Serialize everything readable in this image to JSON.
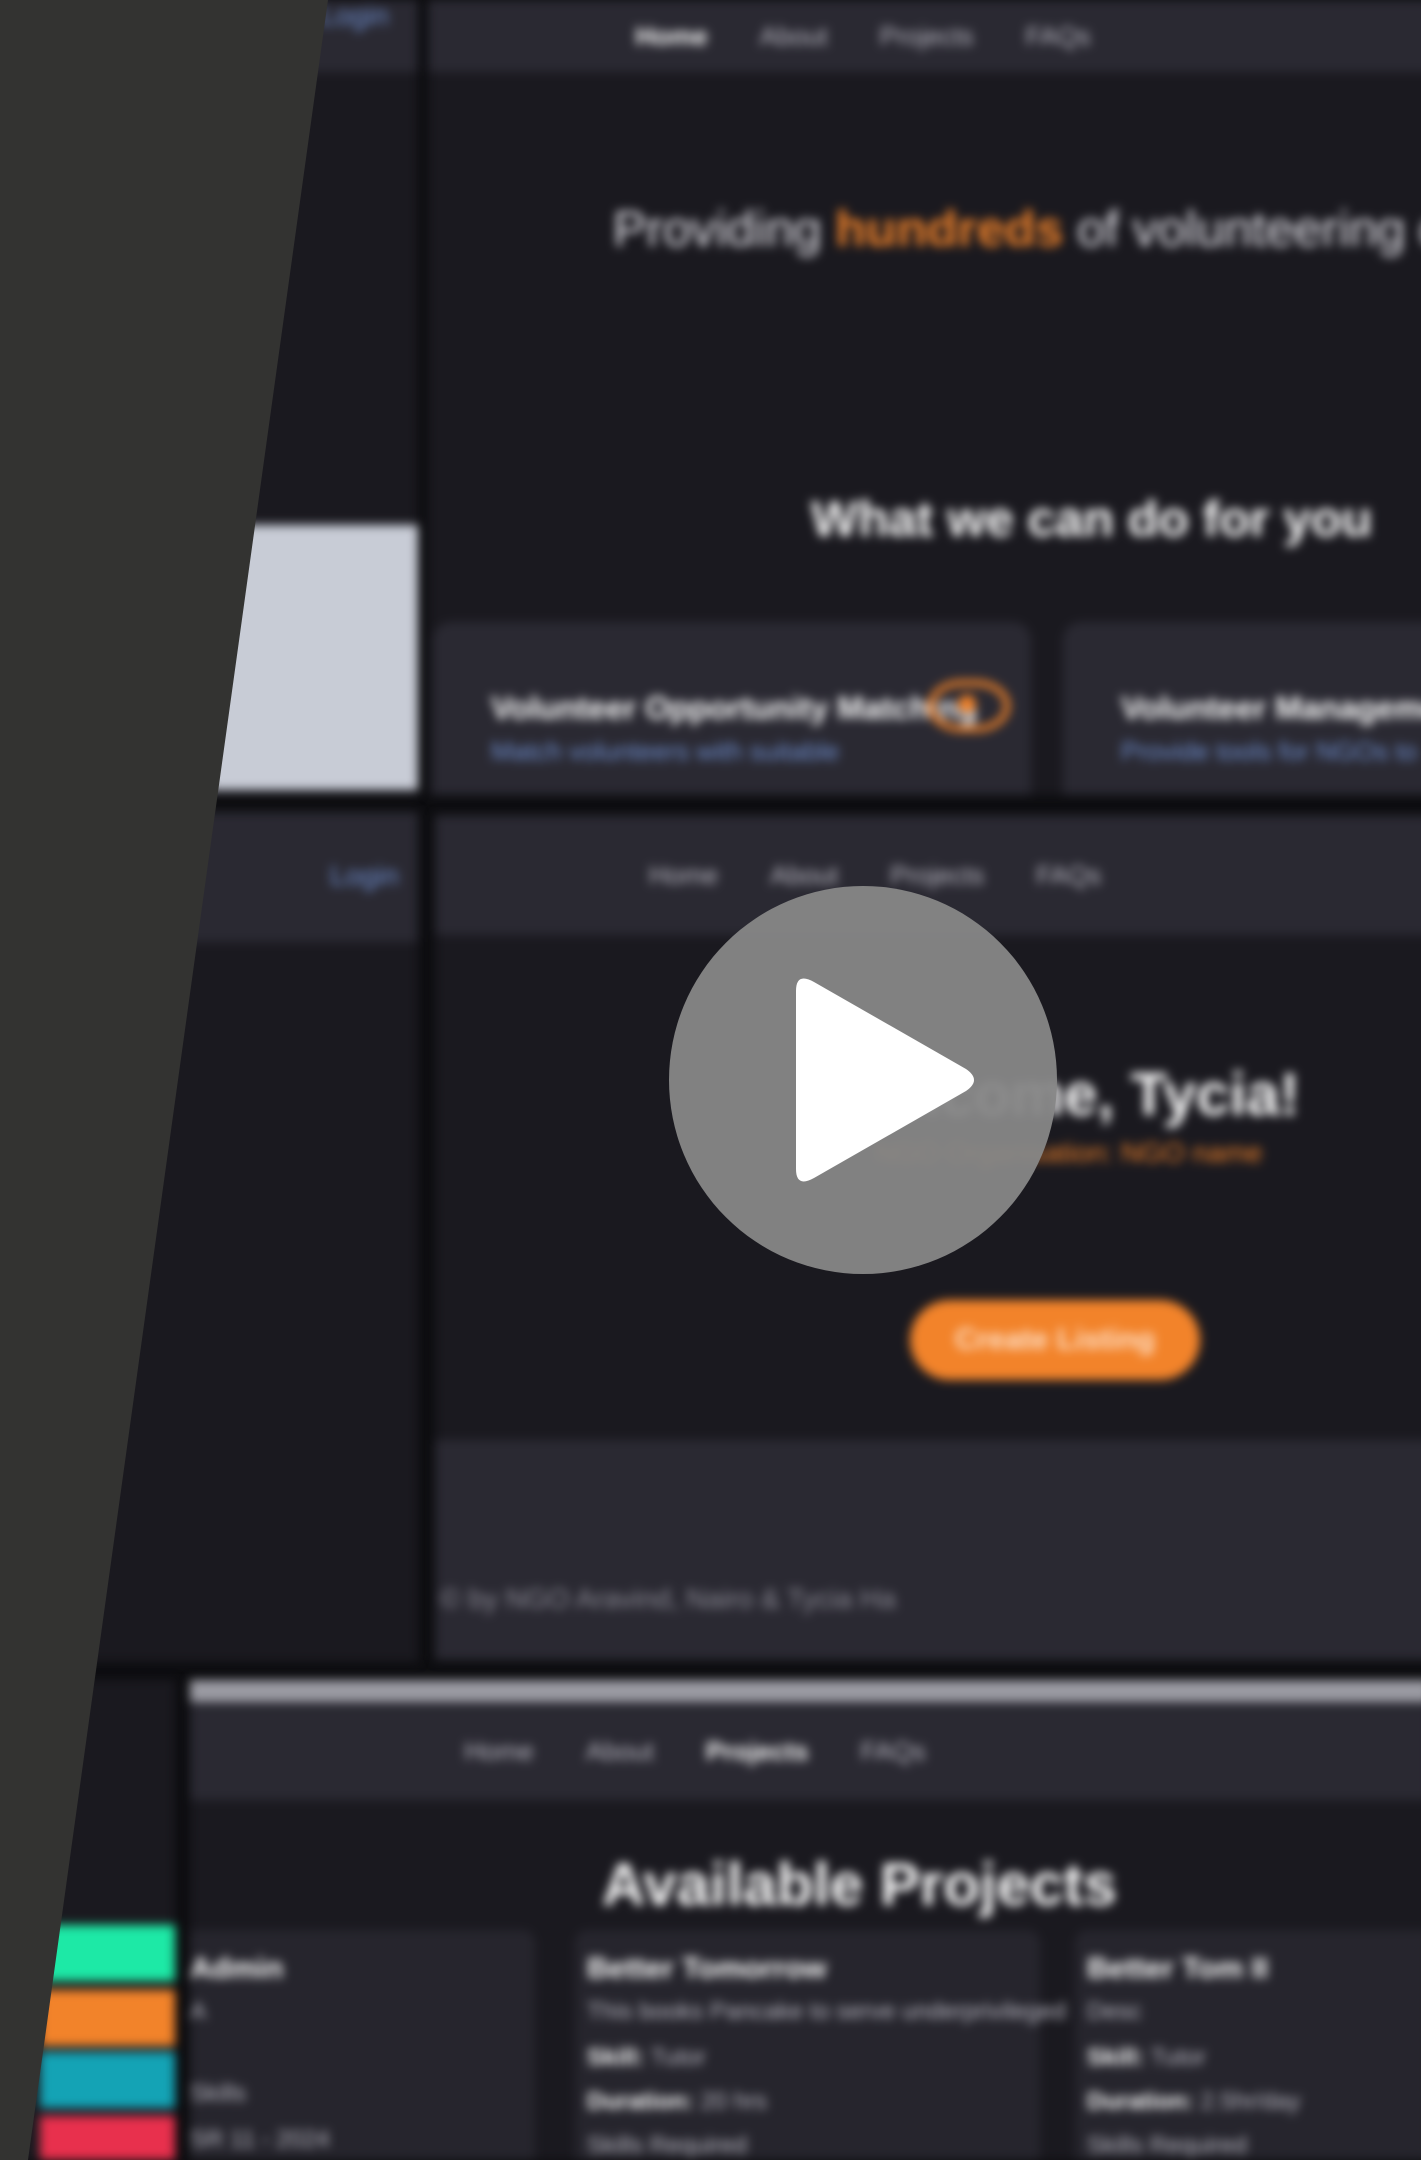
{
  "video": {
    "play_button_label": "Play video"
  },
  "screen_top": {
    "login_label": "Login",
    "nav": [
      "Home",
      "About",
      "Projects",
      "FAQs"
    ],
    "active_nav": "Home",
    "hero_pre": "Providing",
    "hero_accent": "hundreds",
    "hero_post": "of volunteering opportunities",
    "section_heading": "What we can do for you",
    "card1_title": "Volunteer Opportunity Matching",
    "card1_desc": "Match volunteers with suitable",
    "card2_title": "Volunteer Management",
    "card2_desc": "Provide tools for NGOs to"
  },
  "screen_middle": {
    "login_label": "Login",
    "nav": [
      "Home",
      "About",
      "Projects",
      "FAQs"
    ],
    "welcome": "Welcome, Tycia!",
    "subtitle": "NGO Organisation: NGO name",
    "cta_label": "Create Listing",
    "footer": "© by NGO Aravind, Nairo & Tycia Ha"
  },
  "screen_bottom": {
    "nav": [
      "Home",
      "About",
      "Projects",
      "FAQs"
    ],
    "active_nav": "Projects",
    "heading": "Available Projects",
    "cards": [
      {
        "title": "Admin",
        "desc": "A",
        "skill": "Skills",
        "duration": "",
        "slots": "SR 11 - 2024"
      },
      {
        "title": "Better Tomorrow",
        "desc": "This books Pancake to serve underprivileged",
        "skill_label": "Skill:",
        "skill": "Tutor",
        "duration_label": "Duration:",
        "duration": "20 hrs",
        "slots": "Skills Required"
      },
      {
        "title": "Better Tom II",
        "desc": "Desc",
        "skill_label": "Skill:",
        "skill": "Tutor",
        "duration_label": "Duration:",
        "duration": "2.5hr/day",
        "slots": "Skills Required"
      }
    ],
    "tag_colors": [
      "#1de9a6",
      "#f2832a",
      "#14a3b5",
      "#e8304d"
    ]
  },
  "colors": {
    "accent": "#f2832a",
    "link": "#6f8fd0",
    "panel_bg": "#1a191f",
    "nav_bg": "#2a2932",
    "wedge": "#333331",
    "play": "#878787"
  }
}
